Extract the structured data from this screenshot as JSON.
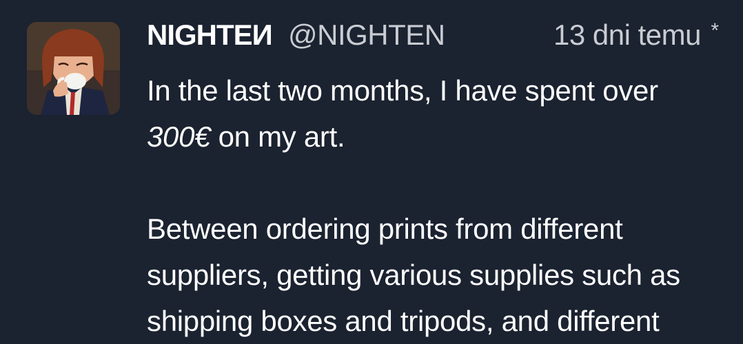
{
  "tweet": {
    "display_name": "NIGHTEИ",
    "handle": "@NIGHTEN",
    "timestamp": "13 dni temu",
    "edited_mark": "*",
    "avatar_icon": "anime-character-drinking-tea-avatar",
    "line1": "In the last two months, I have spent over",
    "amount": "300€",
    "line2_rest": " on my art.",
    "line3": "Between ordering prints from different",
    "line4": "suppliers, getting various supplies such as",
    "line5": "shipping boxes and tripods, and different"
  },
  "colors": {
    "background": "#1b2230",
    "primary_text": "#ffffff",
    "secondary_text": "#c9ccd2"
  }
}
